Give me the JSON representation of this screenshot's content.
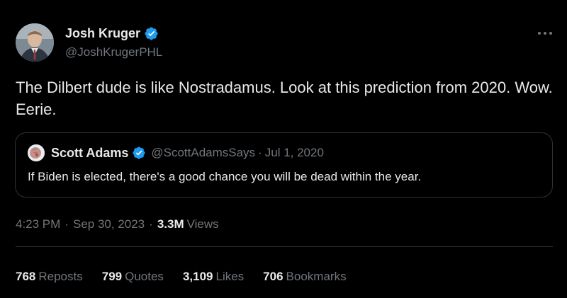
{
  "colors": {
    "background": "#000000",
    "text_primary": "#e7e9ea",
    "text_secondary": "#71767b",
    "border": "#2f3336",
    "verified_badge": "#1d9bf0"
  },
  "author": {
    "name": "Josh Kruger",
    "handle": "@JoshKrugerPHL",
    "verified_icon": "verified-badge-icon",
    "avatar_icon": "profile-photo"
  },
  "more_icon": "more-options-icon",
  "tweet": {
    "text": "The Dilbert dude is like Nostradamus. Look at this prediction from 2020. Wow. Eerie."
  },
  "quote": {
    "name": "Scott Adams",
    "handle": "@ScottAdamsSays",
    "separator": "·",
    "date": "Jul 1, 2020",
    "text": "If Biden is elected, there's a good chance you will be dead within the year."
  },
  "meta": {
    "time": "4:23 PM",
    "separator": "·",
    "date": "Sep 30, 2023",
    "views_count": "3.3M",
    "views_label": "Views"
  },
  "stats": [
    {
      "count": "768",
      "label": "Reposts"
    },
    {
      "count": "799",
      "label": "Quotes"
    },
    {
      "count": "3,109",
      "label": "Likes"
    },
    {
      "count": "706",
      "label": "Bookmarks"
    }
  ]
}
